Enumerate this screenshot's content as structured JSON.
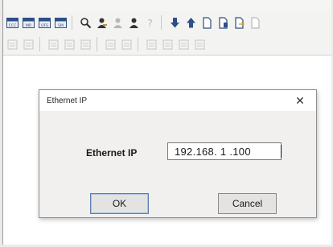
{
  "toolbar": {
    "row1": [
      {
        "icon": "tag-cc-icon",
        "text": "CCC"
      },
      {
        "icon": "tag-mr-icon",
        "text": "MR"
      },
      {
        "icon": "tag-ofs-icon",
        "text": "OFS"
      },
      {
        "icon": "tag-sm-icon",
        "text": "SM"
      },
      {
        "icon": "search-icon"
      },
      {
        "icon": "user-edit-icon"
      },
      {
        "icon": "user-disabled-icon"
      },
      {
        "icon": "user-icon"
      },
      {
        "icon": "help-icon"
      },
      {
        "icon": "download-arrow-icon"
      },
      {
        "icon": "upload-arrow-icon"
      },
      {
        "icon": "document-icon"
      },
      {
        "icon": "document-copy-icon"
      },
      {
        "icon": "document-export-icon"
      },
      {
        "icon": "document-check-icon"
      }
    ],
    "row2": [
      {
        "icon": "disabled-arrow-icon"
      },
      {
        "icon": "disabled-image-icon"
      },
      {
        "icon": "disabled-search-icon"
      },
      {
        "icon": "disabled-list-icon"
      },
      {
        "icon": "disabled-transfer-icon"
      },
      {
        "icon": "disabled-window-icon"
      },
      {
        "icon": "disabled-grid-icon"
      },
      {
        "icon": "disabled-page-icon"
      },
      {
        "icon": "disabled-table-icon"
      },
      {
        "icon": "disabled-print-icon"
      },
      {
        "icon": "disabled-delete-icon"
      }
    ]
  },
  "dialog": {
    "title": "Ethernet IP",
    "close_symbol": "✕",
    "field_label": "Ethernet IP",
    "field_value": "192.168. 1 .100",
    "ok_label": "OK",
    "cancel_label": "Cancel"
  }
}
